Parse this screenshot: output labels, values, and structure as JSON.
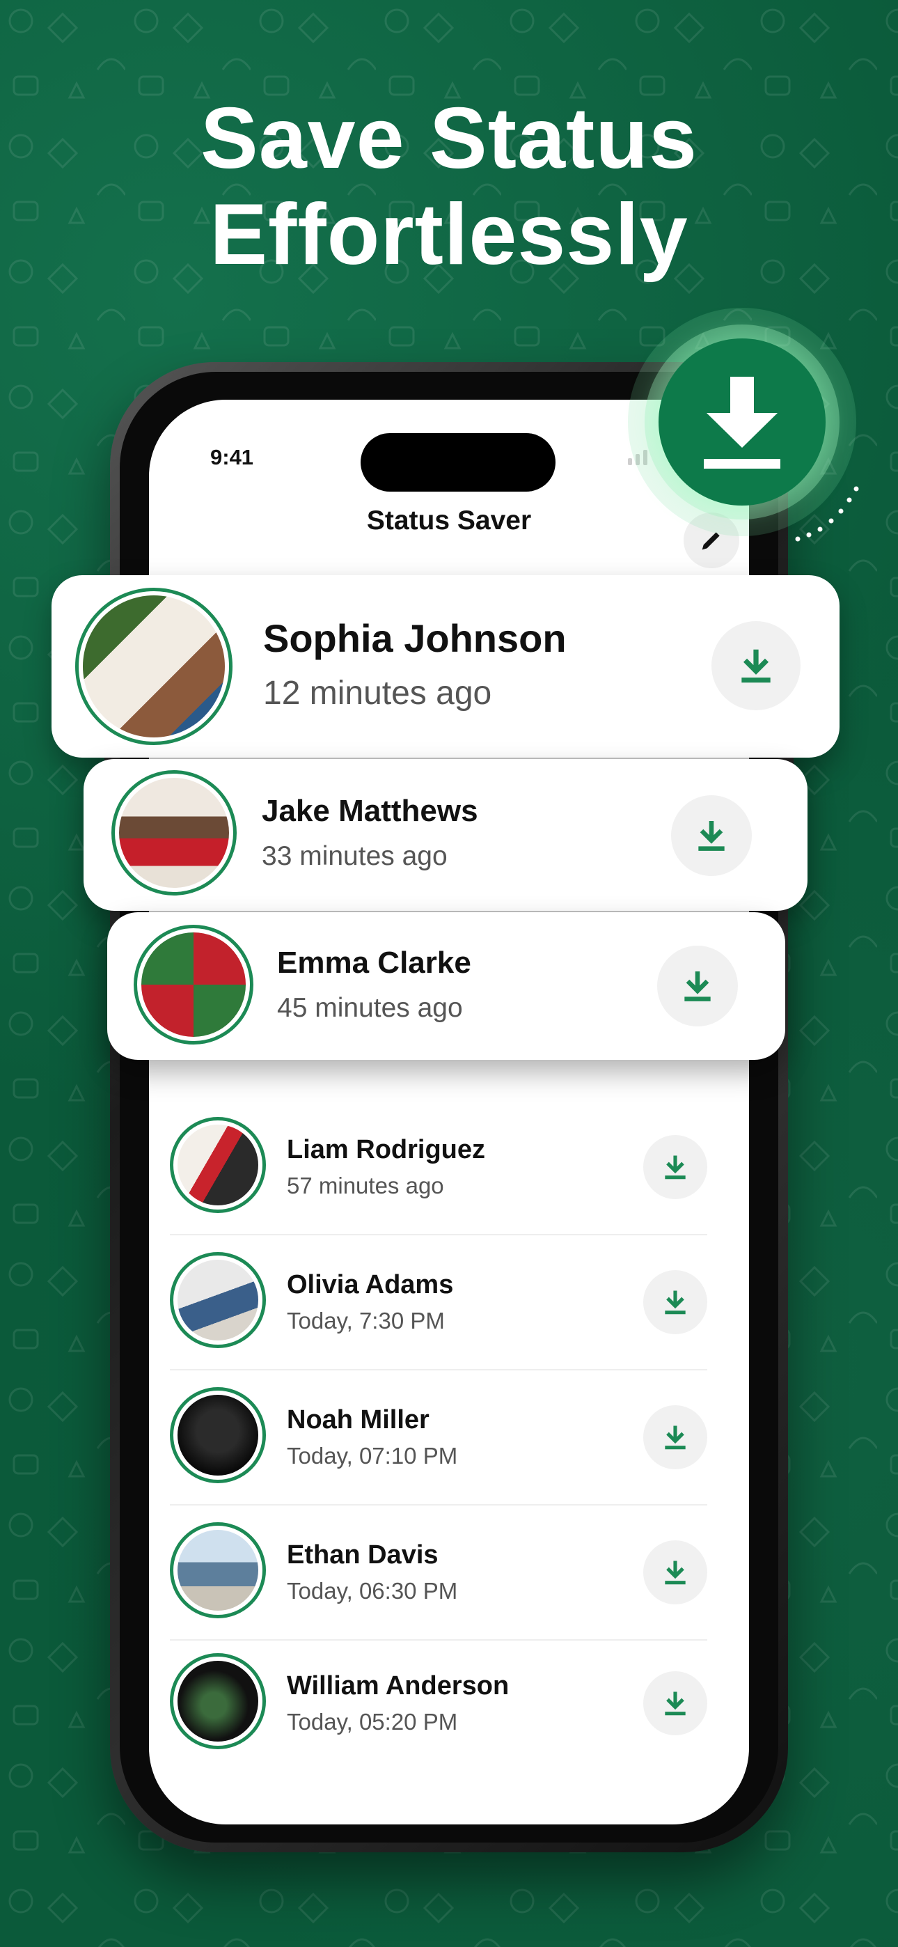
{
  "headline": {
    "line1": "Save Status",
    "line2": "Effortlessly"
  },
  "phone": {
    "time": "9:41",
    "app_title": "Status Saver"
  },
  "colors": {
    "background": "#0b5a3a",
    "accent": "#1c8a55",
    "download_icon": "#1c8a55",
    "card": "#ffffff"
  },
  "icons": {
    "edit": "pencil-icon",
    "download": "download-icon",
    "hero_badge": "download-icon"
  },
  "featured_statuses": [
    {
      "name": "Sophia Johnson",
      "time": "12 minutes ago"
    },
    {
      "name": "Jake Matthews",
      "time": "33 minutes ago"
    },
    {
      "name": "Emma Clarke",
      "time": "45 minutes ago"
    }
  ],
  "statuses": [
    {
      "name": "Liam Rodriguez",
      "time": "57 minutes ago"
    },
    {
      "name": "Olivia Adams",
      "time": "Today, 7:30 PM"
    },
    {
      "name": "Noah Miller",
      "time": "Today, 07:10 PM"
    },
    {
      "name": "Ethan Davis",
      "time": "Today, 06:30 PM"
    },
    {
      "name": "William Anderson",
      "time": "Today, 05:20 PM"
    }
  ]
}
